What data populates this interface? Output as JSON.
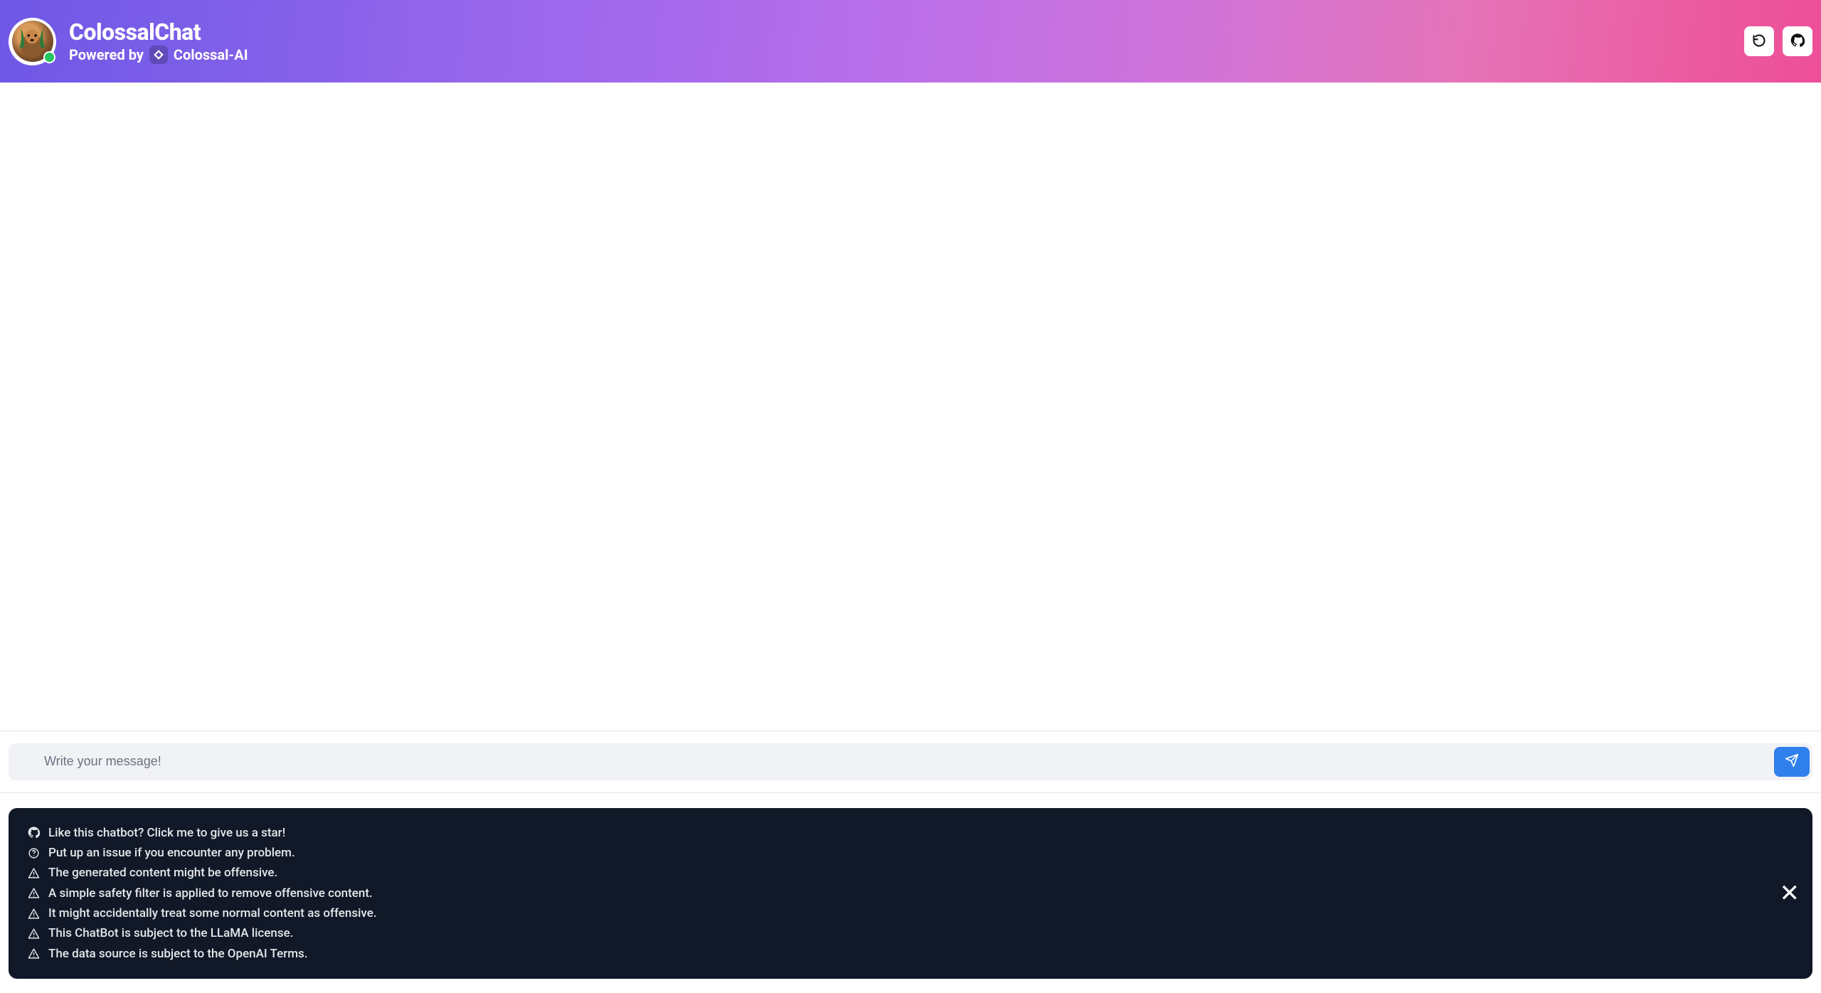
{
  "header": {
    "title": "ColossalChat",
    "powered_prefix": "Powered by",
    "powered_brand": "Colossal-AI"
  },
  "input": {
    "placeholder": "Write your message!"
  },
  "notice": {
    "star_text": "Like this chatbot? Click me to give us a star!",
    "issue_text": "Put up an issue if you encounter any problem.",
    "warnings": [
      "The generated content might be offensive.",
      "A simple safety filter is applied to remove offensive content.",
      "It might accidentally treat some normal content as offensive.",
      "This ChatBot is subject to the LLaMA license.",
      "The data source is subject to the OpenAI Terms."
    ]
  }
}
